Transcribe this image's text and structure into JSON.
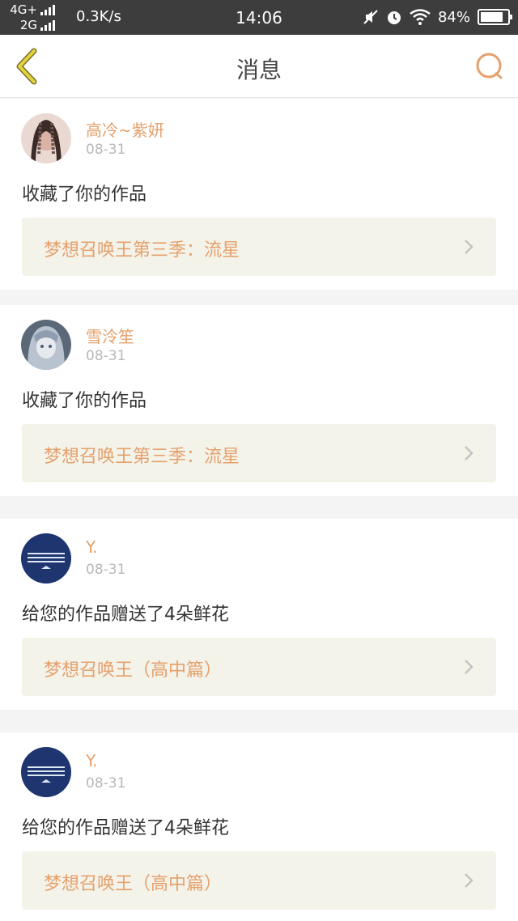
{
  "status_bar": {
    "network_top": "4G+",
    "network_bottom": "2G",
    "speed": "0.3K/s",
    "time": "14:06",
    "battery_percent": "84%",
    "battery_level": 0.84,
    "icons": [
      "mute-icon",
      "alarm-icon",
      "wifi-icon",
      "battery-icon"
    ]
  },
  "header": {
    "title": "消息",
    "back_icon": "chevron-left-icon",
    "search_icon": "search-icon",
    "accent_color": "#e5a06b",
    "back_color": "#d8c84a"
  },
  "messages": [
    {
      "username": "高冷~紫妍",
      "date": "08-31",
      "text": "收藏了你的作品",
      "work_title": "梦想召唤王第三季：流星"
    },
    {
      "username": "雪泠笙",
      "date": "08-31",
      "text": "收藏了你的作品",
      "work_title": "梦想召唤王第三季：流星"
    },
    {
      "username": "Y.",
      "date": "08-31",
      "text": "给您的作品赠送了4朵鲜花",
      "work_title": "梦想召唤王（高中篇）"
    },
    {
      "username": "Y.",
      "date": "08-31",
      "text": "给您的作品赠送了4朵鲜花",
      "work_title": "梦想召唤王（高中篇）"
    }
  ]
}
